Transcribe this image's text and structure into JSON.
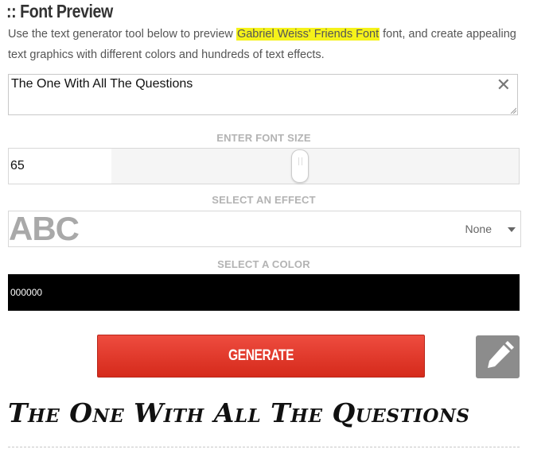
{
  "header": {
    "title": ":: Font Preview"
  },
  "intro": {
    "before": "Use the text generator tool below to preview ",
    "highlight": "Gabriel Weiss' Friends Font",
    "after": " font, and create appealing text graphics with different colors and hundreds of text effects."
  },
  "text_input": {
    "value": "The One With All The Questions",
    "clear_icon": "close-icon"
  },
  "font_size": {
    "label": "ENTER FONT SIZE",
    "value": "65"
  },
  "effect": {
    "label": "SELECT AN EFFECT",
    "sample": "ABC",
    "selected": "None"
  },
  "color": {
    "label": "SELECT A COLOR",
    "value": "000000",
    "swatch": "#000000"
  },
  "actions": {
    "generate_label": "GENERATE",
    "edit_icon": "pencil-icon"
  },
  "preview": {
    "text": "The One With All The Questions"
  },
  "colors": {
    "highlight": "#f5f21a",
    "button_red": "#e23a2b",
    "edit_gray": "#8c8c8c",
    "label_gray": "#b3b3b3"
  }
}
